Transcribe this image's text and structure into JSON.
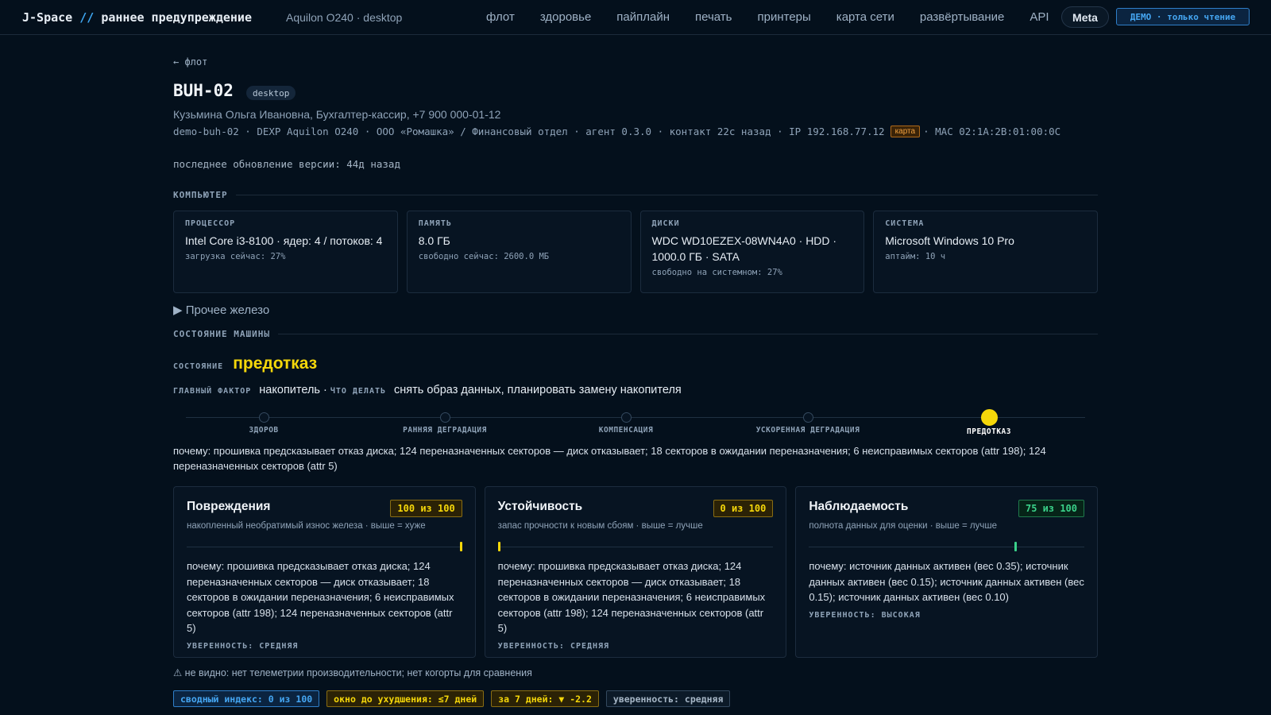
{
  "header": {
    "brand_prefix": "J-Space",
    "brand_slash": "//",
    "brand_title": "раннее предупреждение",
    "subtitle": "Aquilon O240 · desktop",
    "nav": [
      "флот",
      "здоровье",
      "пайплайн",
      "печать",
      "принтеры",
      "карта сети",
      "развёртывание",
      "API"
    ],
    "meta_label": "Meta",
    "demo_badge": "ДЕМО · только чтение"
  },
  "host": {
    "back_link": "← флот",
    "name": "BUH-02",
    "tag": "desktop",
    "owner": "Кузьмина Ольга Ивановна, Бухгалтер-кассир, +7 900 000-01-12",
    "facts_before": "demo-buh-02 · DEXP Aquilon O240 · ООО «Ромашка» / Финансовый отдел · агент 0.3.0 · контакт 22с назад · IP 192.168.77.12",
    "map_badge": "карта",
    "facts_after": "· MAC 02:1A:2B:01:00:0C",
    "last_update": "последнее обновление версии: 44д назад"
  },
  "computer": {
    "section_title": "КОМПЬЮТЕР",
    "cards": [
      {
        "label": "ПРОЦЕССОР",
        "value": "Intel Core i3-8100 · ядер: 4 / потоков: 4",
        "sub": "загрузка сейчас: 27%"
      },
      {
        "label": "ПАМЯТЬ",
        "value": "8.0 ГБ",
        "sub": "свободно сейчас: 2600.0 МБ"
      },
      {
        "label": "ДИСКИ",
        "value": "WDC WD10EZEX-08WN4A0 · HDD · 1000.0 ГБ · SATA",
        "sub": "свободно на системном: 27%"
      },
      {
        "label": "СИСТЕМА",
        "value": "Microsoft Windows 10 Pro",
        "sub": "аптайм: 10 ч"
      }
    ],
    "other_hardware": "▶ Прочее железо"
  },
  "machine_state": {
    "section_title": "СОСТОЯНИЕ МАШИНЫ",
    "state_label": "СОСТОЯНИЕ",
    "state_value": "предотказ",
    "main_factor_label": "ГЛАВНЫЙ ФАКТОР",
    "main_factor_value": "накопитель",
    "todo_label": "ЧТО ДЕЛАТЬ",
    "todo_value": "снять образ данных, планировать замену накопителя",
    "stages": [
      "ЗДОРОВ",
      "РАННЯЯ ДЕГРАДАЦИЯ",
      "КОМПЕНСАЦИЯ",
      "УСКОРЕННАЯ ДЕГРАДАЦИЯ",
      "ПРЕДОТКАЗ"
    ],
    "active_stage": 4,
    "why": "почему: прошивка предсказывает отказ диска; 124 переназначенных секторов — диск отказывает; 18 секторов в ожидании переназначения; 6 неисправимых секторов (attr 198); 124 переназначенных секторов (attr 5)"
  },
  "scores": [
    {
      "title": "Повреждения",
      "badge": "100 из 100",
      "value": 100,
      "color": "#f5d70a",
      "desc": "накопленный необратимый износ железа · выше = хуже",
      "why": "почему: прошивка предсказывает отказ диска; 124 переназначенных секторов — диск отказывает; 18 секторов в ожидании переназначения; 6 неисправимых секторов (attr 198); 124 переназначенных секторов (attr 5)",
      "confidence": "УВЕРЕННОСТЬ: СРЕДНЯЯ"
    },
    {
      "title": "Устойчивость",
      "badge": "0 из 100",
      "value": 0,
      "color": "#f5d70a",
      "desc": "запас прочности к новым сбоям · выше = лучше",
      "why": "почему: прошивка предсказывает отказ диска; 124 переназначенных секторов — диск отказывает; 18 секторов в ожидании переназначения; 6 неисправимых секторов (attr 198); 124 переназначенных секторов (attr 5)",
      "confidence": "УВЕРЕННОСТЬ: СРЕДНЯЯ"
    },
    {
      "title": "Наблюдаемость",
      "badge": "75 из 100",
      "value": 75,
      "color": "#3ad18a",
      "desc": "полнота данных для оценки · выше = лучше",
      "why": "почему: источник данных активен (вес 0.35); источник данных активен (вес 0.15); источник данных активен (вес 0.15); источник данных активен (вес 0.10)",
      "confidence": "УВЕРЕННОСТЬ: ВЫСОКАЯ"
    }
  ],
  "footer": {
    "unseen": "⚠ не видно: нет телеметрии производительности; нет когорты для сравнения",
    "chips": [
      {
        "text": "сводный индекс: 0 из 100",
        "style": "blue"
      },
      {
        "text": "окно до ухудшения: ≤7 дней",
        "style": "yellow"
      },
      {
        "text": "за 7 дней: ▼ -2.2",
        "style": "yellow"
      },
      {
        "text": "уверенность: средняя",
        "style": "gray"
      }
    ]
  }
}
